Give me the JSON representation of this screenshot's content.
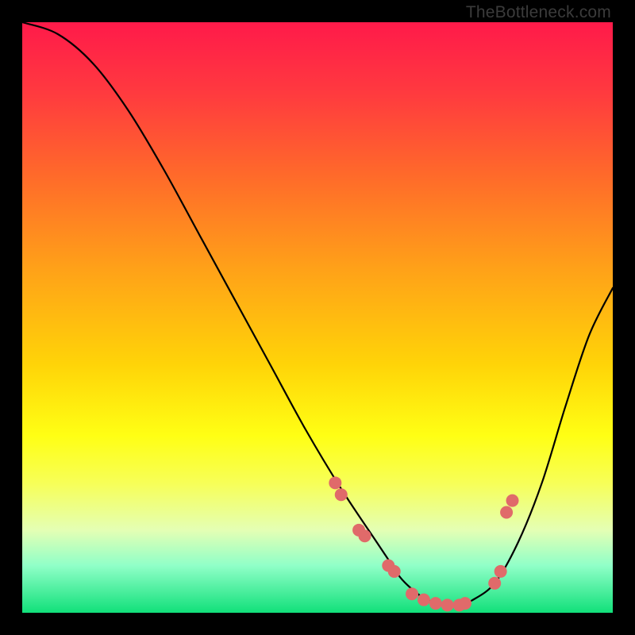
{
  "watermark": "TheBottleneck.com",
  "chart_data": {
    "type": "line",
    "title": "",
    "xlabel": "",
    "ylabel": "",
    "xlim": [
      0,
      100
    ],
    "ylim": [
      0,
      100
    ],
    "series": [
      {
        "name": "bottleneck-curve",
        "x": [
          0,
          6,
          12,
          18,
          24,
          30,
          36,
          42,
          48,
          54,
          60,
          62,
          64,
          66,
          68,
          70,
          72,
          74,
          76,
          80,
          84,
          88,
          92,
          96,
          100
        ],
        "y": [
          100,
          98,
          93,
          85,
          75,
          64,
          53,
          42,
          31,
          21,
          12,
          9,
          6,
          4,
          2.5,
          1.7,
          1.2,
          1.2,
          2,
          5,
          12,
          22,
          35,
          47,
          55
        ]
      }
    ],
    "markers": {
      "name": "highlight-points",
      "x": [
        53,
        54,
        57,
        58,
        62,
        63,
        66,
        68,
        70,
        72,
        74,
        75,
        80,
        81,
        82,
        83
      ],
      "y": [
        22,
        20,
        14,
        13,
        8,
        7,
        3.2,
        2.2,
        1.6,
        1.3,
        1.3,
        1.6,
        5,
        7,
        17,
        19
      ]
    },
    "gradient_stops": [
      {
        "pos": 0.0,
        "color": "#ff1a4a"
      },
      {
        "pos": 0.7,
        "color": "#ffff14"
      },
      {
        "pos": 1.0,
        "color": "#11e07a"
      }
    ]
  }
}
